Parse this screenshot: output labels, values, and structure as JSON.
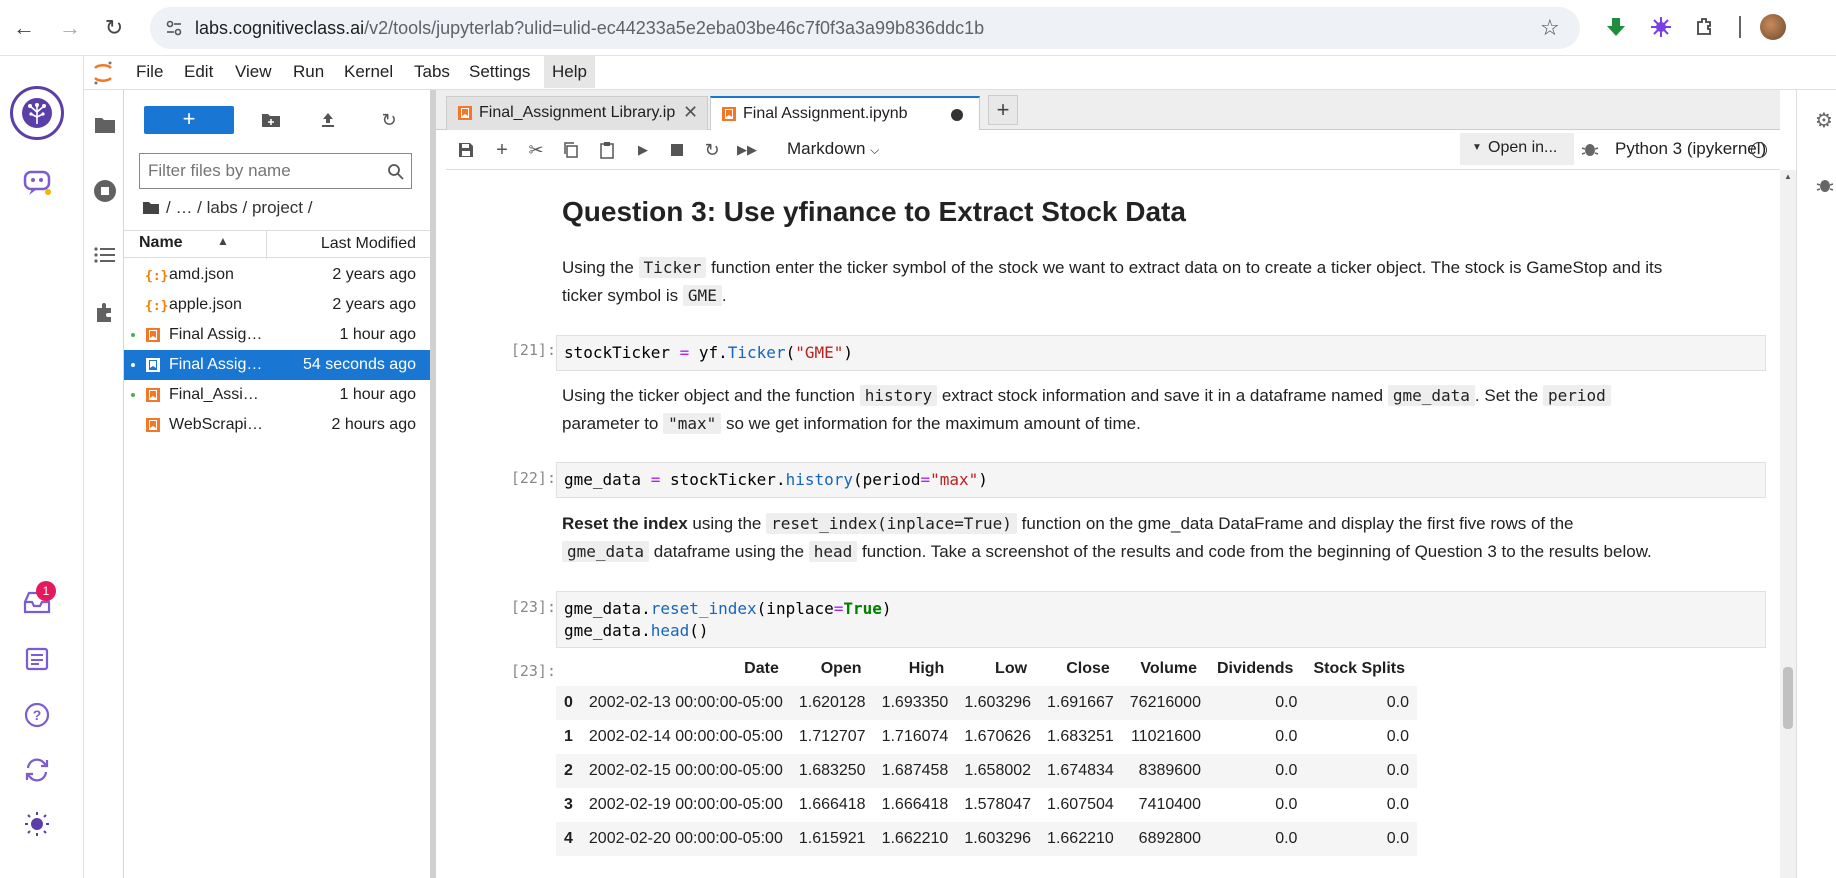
{
  "browser": {
    "url_host": "labs.cognitiveclass.ai",
    "url_path": "/v2/tools/jupyterlab?ulid=ulid-ec44233a5e2eba03be46c7f0f3a3a99b836ddc1b"
  },
  "menu": {
    "items": [
      "File",
      "Edit",
      "View",
      "Run",
      "Kernel",
      "Tabs",
      "Settings",
      "Help"
    ]
  },
  "skills": {
    "notifications_badge": "1"
  },
  "file_browser": {
    "filter_placeholder": "Filter files by name",
    "breadcrumb": "/   …   / labs / project /",
    "col_name": "Name",
    "col_modified": "Last Modified",
    "files": [
      {
        "name": "amd.json",
        "modified": "2 years ago",
        "type": "json",
        "running": false,
        "selected": false
      },
      {
        "name": "apple.json",
        "modified": "2 years ago",
        "type": "json",
        "running": false,
        "selected": false
      },
      {
        "name": "Final Assig…",
        "modified": "1 hour ago",
        "type": "notebook",
        "running": true,
        "selected": false
      },
      {
        "name": "Final Assig…",
        "modified": "54 seconds ago",
        "type": "notebook",
        "running": true,
        "selected": true
      },
      {
        "name": "Final_Assi…",
        "modified": "1 hour ago",
        "type": "notebook",
        "running": true,
        "selected": false
      },
      {
        "name": "WebScrapi…",
        "modified": "2 hours ago",
        "type": "notebook",
        "running": false,
        "selected": false
      }
    ]
  },
  "tabs": [
    {
      "label": "Final_Assignment Library.ipy"
    },
    {
      "label": "Final Assignment.ipynb"
    }
  ],
  "toolbar": {
    "cell_type": "Markdown",
    "open_in": "Open in...",
    "kernel": "Python 3 (ipykernel)"
  },
  "notebook": {
    "heading": "Question 3: Use yfinance to Extract Stock Data",
    "p1": {
      "a": "Using the ",
      "code1": "Ticker",
      "b": " function enter the ticker symbol of the stock we want to extract data on to create a ticker object. The stock is GameStop and its",
      "c": "ticker symbol is ",
      "code2": "GME",
      "d": "."
    },
    "cell21": {
      "prompt": "[21]:",
      "code": "stockTicker = yf.Ticker(\"GME\")"
    },
    "p2": {
      "a": "Using the ticker object and the function ",
      "code1": "history",
      "b": " extract stock information and save it in a dataframe named ",
      "code2": "gme_data",
      "c": ". Set the ",
      "code3": "period",
      "d": "parameter to ",
      "code4": "\"max\"",
      "e": " so we get information for the maximum amount of time."
    },
    "cell22": {
      "prompt": "[22]:",
      "code": "gme_data = stockTicker.history(period=\"max\")"
    },
    "p3": {
      "bold": "Reset the index",
      "a": " using the ",
      "code1": "reset_index(inplace=True)",
      "b": " function on the gme_data DataFrame and display the first five rows of the",
      "code2": "gme_data",
      "c": " dataframe using the ",
      "code3": "head",
      "d": " function. Take a screenshot of the results and code from the beginning of Question 3 to the results below."
    },
    "cell23": {
      "prompt": "[23]:",
      "line1": "gme_data.reset_index(inplace=True)",
      "line2": "gme_data.head()"
    },
    "output23": {
      "prompt": "[23]:",
      "columns": [
        "",
        "Date",
        "Open",
        "High",
        "Low",
        "Close",
        "Volume",
        "Dividends",
        "Stock Splits"
      ],
      "rows": [
        [
          "0",
          "2002-02-13 00:00:00-05:00",
          "1.620128",
          "1.693350",
          "1.603296",
          "1.691667",
          "76216000",
          "0.0",
          "0.0"
        ],
        [
          "1",
          "2002-02-14 00:00:00-05:00",
          "1.712707",
          "1.716074",
          "1.670626",
          "1.683251",
          "11021600",
          "0.0",
          "0.0"
        ],
        [
          "2",
          "2002-02-15 00:00:00-05:00",
          "1.683250",
          "1.687458",
          "1.658002",
          "1.674834",
          "8389600",
          "0.0",
          "0.0"
        ],
        [
          "3",
          "2002-02-19 00:00:00-05:00",
          "1.666418",
          "1.666418",
          "1.578047",
          "1.607504",
          "7410400",
          "0.0",
          "0.0"
        ],
        [
          "4",
          "2002-02-20 00:00:00-05:00",
          "1.615921",
          "1.662210",
          "1.603296",
          "1.662210",
          "6892800",
          "0.0",
          "0.0"
        ]
      ]
    }
  }
}
